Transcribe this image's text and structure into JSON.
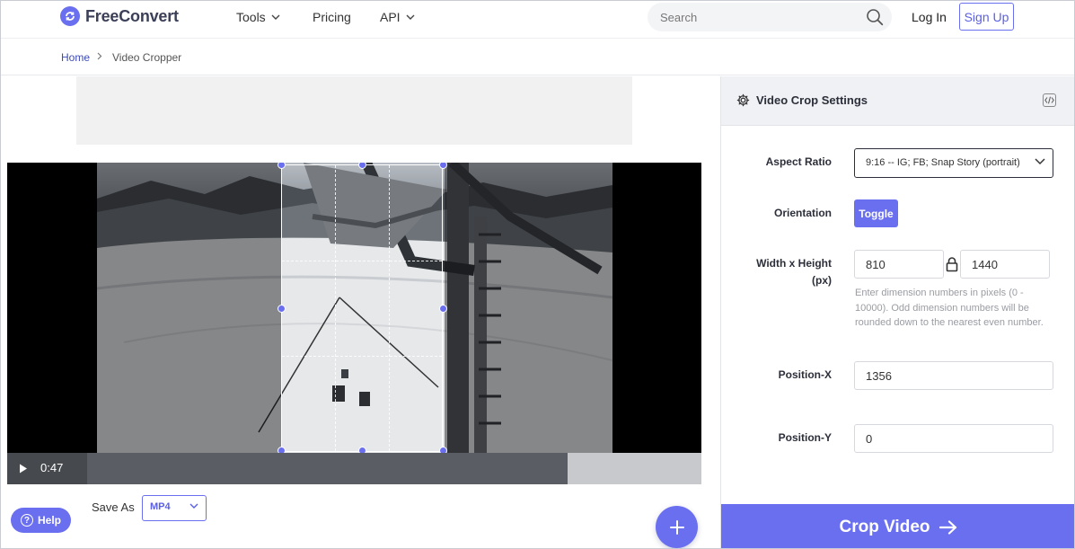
{
  "header": {
    "logo_text": "FreeConvert",
    "nav": [
      {
        "label": "Tools",
        "has_dropdown": true
      },
      {
        "label": "Pricing",
        "has_dropdown": false
      },
      {
        "label": "API",
        "has_dropdown": true
      }
    ],
    "search_placeholder": "Search",
    "login_label": "Log In",
    "signup_label": "Sign Up"
  },
  "breadcrumb": {
    "home": "Home",
    "current": "Video Cropper"
  },
  "player": {
    "time": "0:47",
    "play_icon": "play-icon"
  },
  "save_as": {
    "label": "Save As",
    "selected": "MP4"
  },
  "help_label": "Help",
  "settings": {
    "title": "Video Crop Settings",
    "aspect_ratio_label": "Aspect Ratio",
    "aspect_ratio_value": "9:16 -- IG; FB; Snap Story (portrait)",
    "orientation_label": "Orientation",
    "toggle_label": "Toggle",
    "wh_label_line1": "Width x Height",
    "wh_label_line2": "(px)",
    "width": "810",
    "height": "1440",
    "hint": "Enter dimension numbers in pixels (0 - 10000). Odd dimension numbers will be rounded down to the nearest even number.",
    "position_x_label": "Position-X",
    "position_x": "1356",
    "position_y_label": "Position-Y",
    "position_y": "0"
  },
  "crop_button_label": "Crop Video",
  "colors": {
    "accent": "#6a6ff0",
    "link": "#3d4ab8",
    "panel_header": "#f0f1f4"
  }
}
